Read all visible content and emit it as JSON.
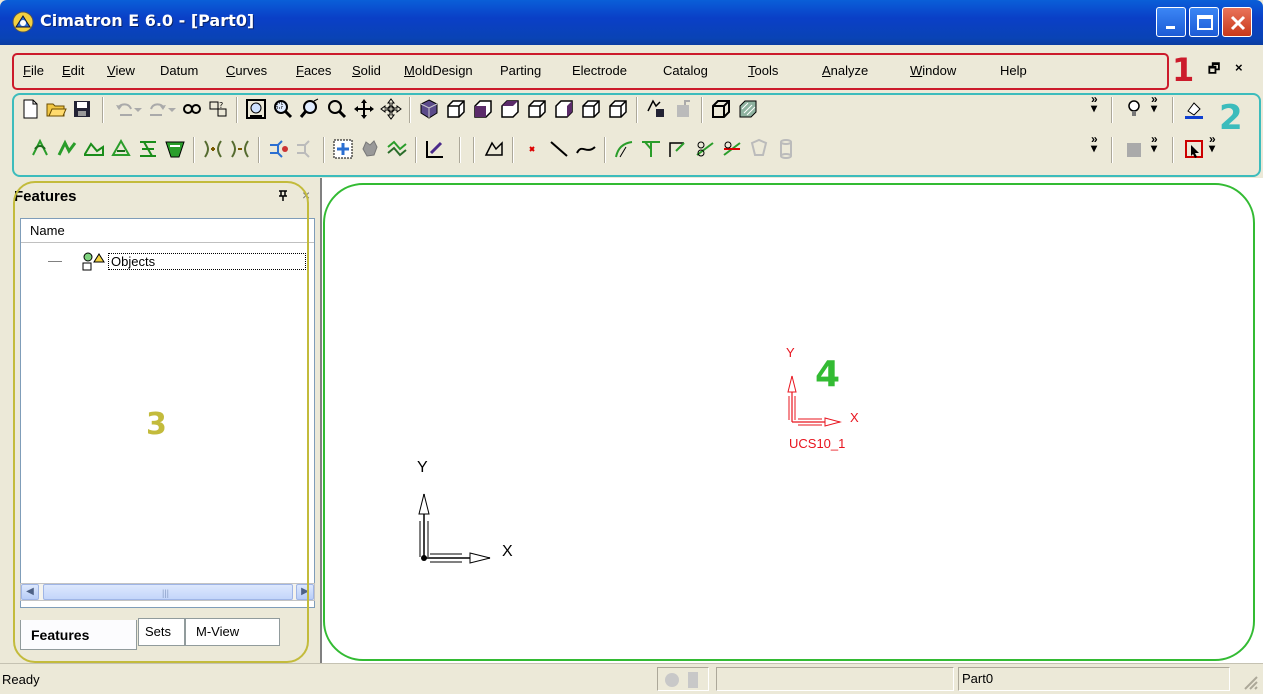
{
  "window": {
    "title": "Cimatron E 6.0 - [Part0]",
    "title_color": "#ffffff",
    "titlebar_color": "#0a3fc7"
  },
  "menu": {
    "items": [
      "File",
      "Edit",
      "View",
      "Datum",
      "Curves",
      "Faces",
      "Solid",
      "MoldDesign",
      "Parting",
      "Electrode",
      "Catalog",
      "Tools",
      "Analyze",
      "Window",
      "Help"
    ],
    "mnemonic_letters": [
      "F",
      "E",
      "V",
      "",
      "C",
      "F",
      "S",
      "M",
      "",
      "",
      "",
      "T",
      "A",
      "W",
      ""
    ],
    "restore_glyph": "🗗",
    "close_glyph": "×"
  },
  "annotations": {
    "label_1": "1",
    "label_2": "2",
    "label_3": "3",
    "label_4": "4",
    "color_1": "#cc1b2b",
    "color_2": "#3cbcbc",
    "color_3": "#c3bb3c",
    "color_4": "#33bb33"
  },
  "features_panel": {
    "title": "Features",
    "column_header": "Name",
    "tree_items": [
      "Objects"
    ],
    "tabs": [
      "Features",
      "Sets",
      "M-View"
    ],
    "active_tab": "Features"
  },
  "viewport": {
    "world_axis": {
      "x_label": "X",
      "y_label": "Y",
      "color": "#000000"
    },
    "ucs": {
      "x_label": "X",
      "y_label": "Y",
      "name": "UCS10_1",
      "color": "#e8141e"
    }
  },
  "status": {
    "text": "Ready",
    "part": "Part0"
  }
}
